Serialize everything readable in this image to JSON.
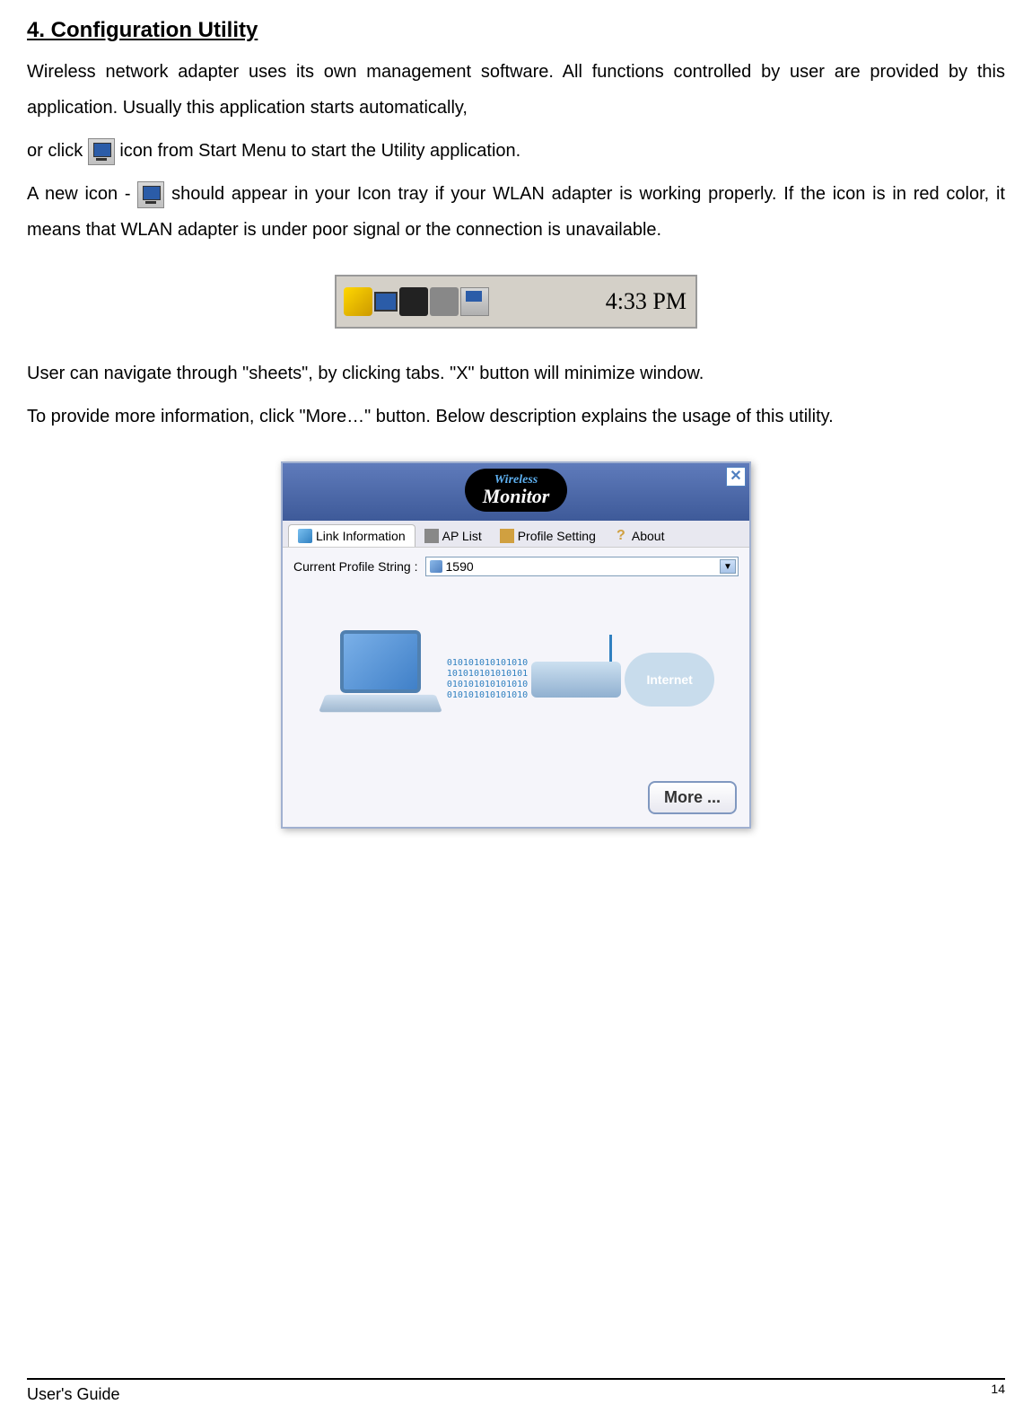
{
  "heading": "4. Configuration Utility",
  "p1": "Wireless network adapter uses its own management software. All functions controlled by user are provided by this application. Usually this application starts automatically,",
  "p2a": "or click ",
  "p2b": " icon from Start Menu to start the Utility application.",
  "p3a": "A new icon - ",
  "p3b": " should appear in your Icon tray if your WLAN adapter is working properly. If the icon is in red color, it means that WLAN adapter is under poor signal or the connection is unavailable.",
  "p4": "User can navigate through \"sheets\", by clicking tabs.  \"X\" button will minimize window.",
  "p5": "To provide more information, click \"More…\" button. Below description explains the usage of this utility.",
  "tray": {
    "time": "4:33 PM"
  },
  "monitor": {
    "title_top": "Wireless",
    "title_bottom": "Monitor",
    "close": "✕",
    "tabs": {
      "link": "Link Information",
      "ap": "AP List",
      "profile": "Profile Setting",
      "about": "About"
    },
    "profile_label": "Current Profile String :",
    "profile_value": "1590",
    "internet": "Internet",
    "more": "More ..."
  },
  "footer": {
    "left": "User's Guide",
    "page": "14"
  }
}
